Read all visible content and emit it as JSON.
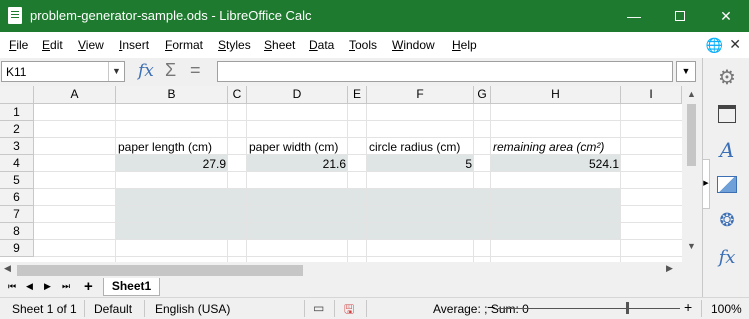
{
  "window": {
    "title": "problem-generator-sample.ods - LibreOffice Calc",
    "minimize_icon": "minimize-icon",
    "maximize_icon": "maximize-icon",
    "close_icon": "close-icon"
  },
  "menubar": {
    "items": [
      {
        "label": "File"
      },
      {
        "label": "Edit"
      },
      {
        "label": "View"
      },
      {
        "label": "Insert"
      },
      {
        "label": "Format"
      },
      {
        "label": "Styles"
      },
      {
        "label": "Sheet"
      },
      {
        "label": "Data"
      },
      {
        "label": "Tools"
      },
      {
        "label": "Window"
      },
      {
        "label": "Help"
      }
    ]
  },
  "formula_bar": {
    "name_box": "K11",
    "fx": "fx",
    "sigma": "Σ",
    "equals": "=",
    "content": ""
  },
  "columns": [
    "A",
    "B",
    "C",
    "D",
    "E",
    "F",
    "G",
    "H",
    "I"
  ],
  "rows": [
    "1",
    "2",
    "3",
    "4",
    "5",
    "6",
    "7",
    "8",
    "9"
  ],
  "cells": {
    "B3": "paper length (cm)",
    "D3": "paper width (cm)",
    "F3": "circle radius (cm)",
    "H3": "remaining area (cm²)",
    "B4": "27.9",
    "D4": "21.6",
    "F4": "5",
    "H4": "524.1"
  },
  "sheet_tabs": [
    "Sheet1"
  ],
  "status": {
    "sheet": "Sheet 1 of 1",
    "page_style": "Default",
    "language": "English (USA)",
    "summary": "Average: ; Sum: 0",
    "zoom_minus": "−",
    "zoom_plus": "+",
    "zoom": "100%"
  },
  "colors": {
    "titlebar": "#1e7a2e",
    "cell_shade": "#dfe5e4",
    "accent": "#3c6fb4"
  }
}
